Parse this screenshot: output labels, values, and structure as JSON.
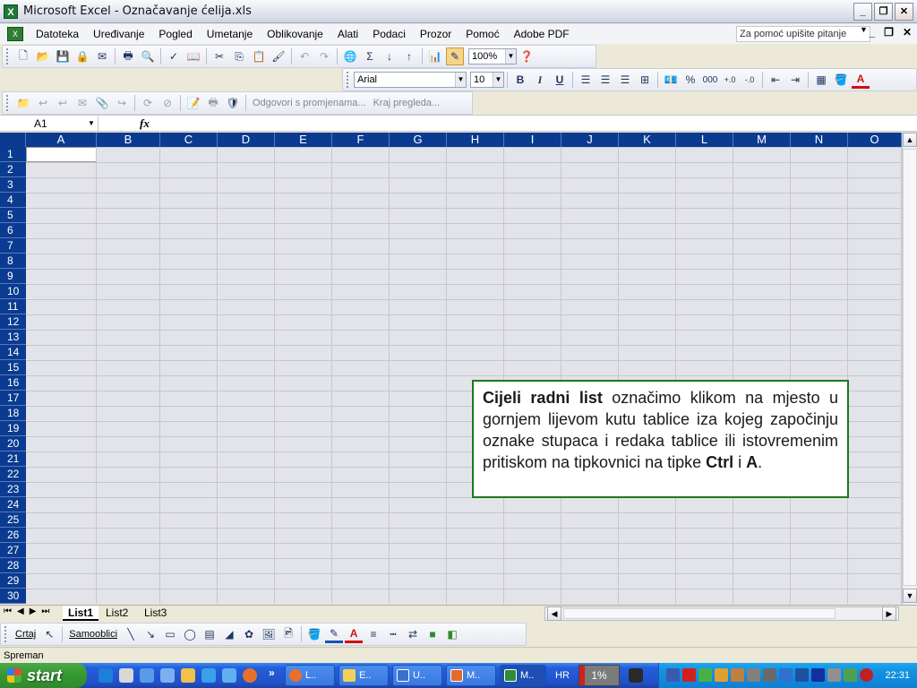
{
  "window": {
    "title": "Microsoft Excel - Označavanje ćelija.xls"
  },
  "menubar": {
    "items": [
      "Datoteka",
      "Uređivanje",
      "Pogled",
      "Umetanje",
      "Oblikovanje",
      "Alati",
      "Podaci",
      "Prozor",
      "Pomoć",
      "Adobe PDF"
    ],
    "help_placeholder": "Za pomoć upišite pitanje"
  },
  "standard_toolbar": {
    "zoom": "100%"
  },
  "formatting_toolbar": {
    "font": "Arial",
    "size": "10",
    "bold": "B",
    "italic": "I",
    "underline": "U",
    "percent": "%",
    "thousands": "000"
  },
  "review_toolbar": {
    "reply_label": "Odgovori s promjenama...",
    "end_label": "Kraj pregleda..."
  },
  "formula_bar": {
    "name_box": "A1",
    "fx": "fx",
    "value": ""
  },
  "grid": {
    "columns": [
      "A",
      "B",
      "C",
      "D",
      "E",
      "F",
      "G",
      "H",
      "I",
      "J",
      "K",
      "L",
      "M",
      "N",
      "O"
    ],
    "rows": [
      "1",
      "2",
      "3",
      "4",
      "5",
      "6",
      "7",
      "8",
      "9",
      "10",
      "11",
      "12",
      "13",
      "14",
      "15",
      "16",
      "17",
      "18",
      "19",
      "20",
      "21",
      "22",
      "23",
      "24",
      "25",
      "26",
      "27",
      "28",
      "29",
      "30"
    ],
    "active_cell": "A1"
  },
  "sheets": {
    "tabs": [
      "List1",
      "List2",
      "List3"
    ],
    "active": "List1"
  },
  "drawing_toolbar": {
    "draw_label": "Crtaj",
    "autoshapes_label": "Samooblici"
  },
  "status": {
    "text": "Spreman"
  },
  "callout": {
    "part1": "Cijeli radni list",
    "part2": " označimo klikom na mjesto u gornjem lijevom kutu tablice iza kojeg započinju oznake stupaca i redaka tablice ili istovremenim pritiskom na tipkovnici na tipke ",
    "part3": "Ctrl",
    "part4": " i ",
    "part5": "A",
    "part6": "."
  },
  "taskbar": {
    "start_label": "start",
    "buttons": [
      "L..",
      "E..",
      "U..",
      "M..",
      "M.."
    ],
    "language": "HR",
    "progress_label": "1%",
    "clock": "22:31"
  },
  "colors": {
    "header_blue": "#0a3b91",
    "callout_border": "#1b7a1b",
    "taskbar_blue": "#245edb",
    "start_green": "#379a33"
  }
}
